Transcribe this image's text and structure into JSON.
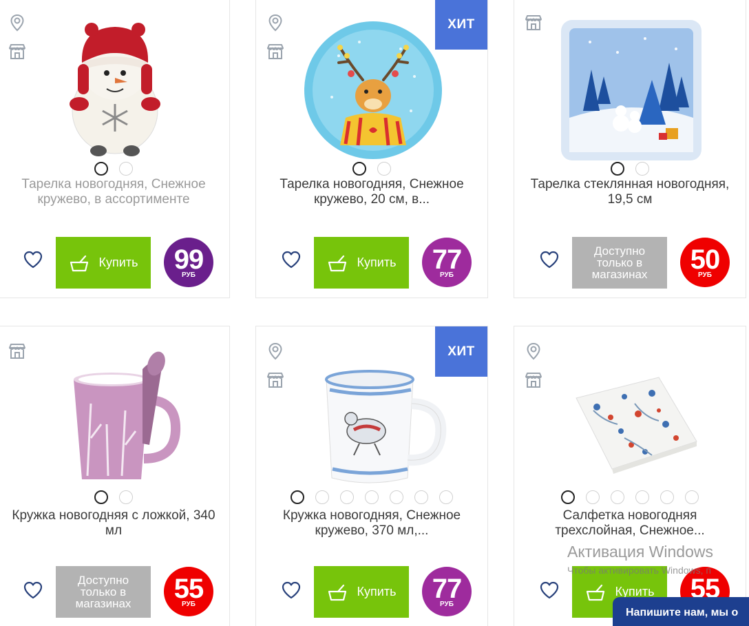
{
  "currency": "РУБ",
  "buy_label": "Купить",
  "hit_label": "ХИТ",
  "unavailable_label": "Доступно только в магазинах",
  "colors": {
    "buy": "#77c40b",
    "hit": "#4a73d9",
    "unavailable": "#b3b3b3",
    "price_purple": "#6a1f8c",
    "price_magenta": "#9e2b9d",
    "price_red": "#ef0000",
    "chat": "#1d3f8f"
  },
  "products": [
    {
      "title": "Тарелка новогодняя, Снежное кружево, в ассортименте",
      "price": "99",
      "price_color": "purple",
      "action": "buy",
      "hit": false,
      "icons": [
        "location-pin-icon",
        "store-icon"
      ],
      "image": "snowman-plate",
      "dots": 2,
      "title_style": "grey"
    },
    {
      "title": "Тарелка новогодняя, Снежное кружево, 20 см, в...",
      "price": "77",
      "price_color": "magenta",
      "action": "buy",
      "hit": true,
      "icons": [
        "location-pin-icon",
        "store-icon"
      ],
      "image": "reindeer-plate",
      "dots": 2,
      "title_style": "dark"
    },
    {
      "title": "Тарелка стеклянная новогодняя, 19,5 см",
      "price": "50",
      "price_color": "red",
      "action": "unavailable",
      "hit": false,
      "icons": [
        "store-icon"
      ],
      "image": "glass-plate",
      "dots": 2,
      "title_style": "dark"
    },
    {
      "title": "Кружка новогодняя с ложкой, 340 мл",
      "price": "55",
      "price_color": "red",
      "action": "unavailable",
      "hit": false,
      "icons": [
        "store-icon"
      ],
      "image": "pink-mug",
      "dots": 2,
      "title_style": "dark"
    },
    {
      "title": "Кружка новогодняя, Снежное кружево, 370 мл,...",
      "price": "77",
      "price_color": "magenta",
      "action": "buy",
      "hit": true,
      "icons": [
        "location-pin-icon",
        "store-icon"
      ],
      "image": "skater-mug",
      "dots": 7,
      "title_style": "dark"
    },
    {
      "title": "Салфетка новогодняя трехслойная, Снежное...",
      "price": "55",
      "price_color": "red",
      "action": "buy",
      "hit": false,
      "icons": [
        "location-pin-icon",
        "store-icon"
      ],
      "image": "napkins",
      "dots": 6,
      "title_style": "dark"
    }
  ],
  "watermark": {
    "title": "Активация Windows",
    "subtitle": "Чтобы активировать Windows, п"
  },
  "chat": {
    "label": "Напишите нам, мы о"
  }
}
